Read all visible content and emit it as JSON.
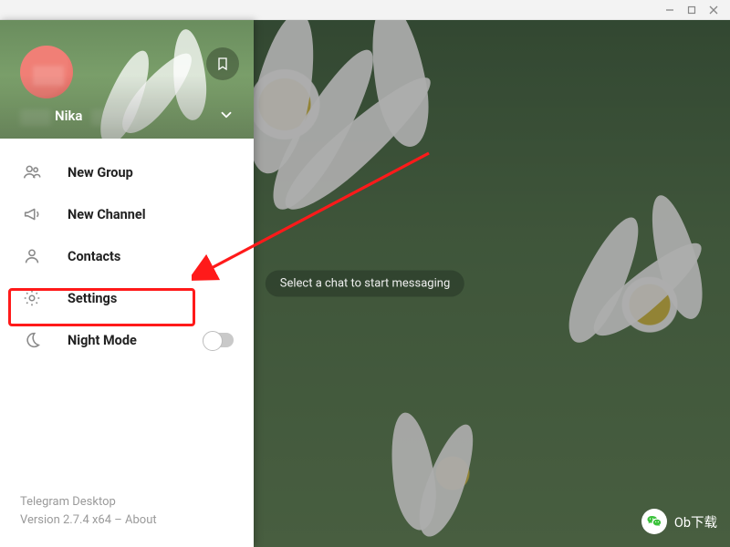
{
  "window": {
    "minimize_tooltip": "Minimize",
    "maximize_tooltip": "Maximize",
    "close_tooltip": "Close"
  },
  "header": {
    "username": "Nika",
    "bookmark_tooltip": "Saved Messages"
  },
  "menu": {
    "items": [
      {
        "label": "New Group",
        "icon": "group-icon"
      },
      {
        "label": "New Channel",
        "icon": "megaphone-icon"
      },
      {
        "label": "Contacts",
        "icon": "person-icon"
      },
      {
        "label": "Settings",
        "icon": "gear-icon"
      },
      {
        "label": "Night Mode",
        "icon": "moon-icon",
        "toggle": true,
        "toggle_on": false
      }
    ]
  },
  "chat": {
    "hint": "Select a chat to start messaging"
  },
  "footer": {
    "app_name": "Telegram Desktop",
    "version_line": "Version 2.7.4 x64 – About"
  },
  "annotation": {
    "highlighted_item_index": 3,
    "color": "#ff1a1a"
  },
  "watermark": {
    "text": "Ob下载"
  }
}
